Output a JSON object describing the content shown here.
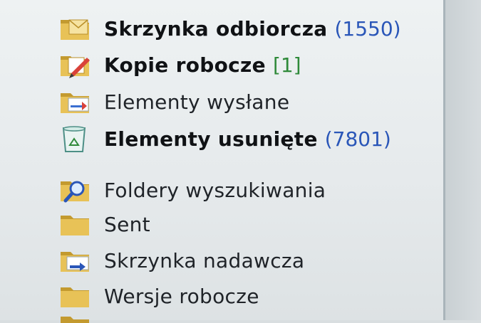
{
  "folders": [
    {
      "icon": "inbox-folder-icon",
      "label": "Skrzynka odbiorcza",
      "count": "(1550)",
      "style": "bold",
      "count_type": "unread"
    },
    {
      "icon": "drafts-folder-icon",
      "label": "Kopie robocze",
      "count": "[1]",
      "style": "bold",
      "count_type": "drafts"
    },
    {
      "icon": "sent-folder-icon",
      "label": "Elementy wysłane",
      "count": "",
      "style": "normal",
      "count_type": ""
    },
    {
      "icon": "deleted-items-icon",
      "label": "Elementy usunięte",
      "count": "(7801)",
      "style": "bold",
      "count_type": "unread"
    },
    {
      "icon": "search-folder-icon",
      "label": "Foldery wyszukiwania",
      "count": "",
      "style": "normal",
      "count_type": ""
    },
    {
      "icon": "folder-icon",
      "label": "Sent",
      "count": "",
      "style": "normal",
      "count_type": ""
    },
    {
      "icon": "outbox-folder-icon",
      "label": "Skrzynka nadawcza",
      "count": "",
      "style": "normal",
      "count_type": ""
    },
    {
      "icon": "folder-icon",
      "label": "Wersje robocze",
      "count": "",
      "style": "normal",
      "count_type": ""
    }
  ],
  "colors": {
    "unread_count": "#2a56b8",
    "drafts_count": "#2f8a3a",
    "folder_yellow": "#e8c257",
    "folder_dark": "#c39a2f"
  }
}
